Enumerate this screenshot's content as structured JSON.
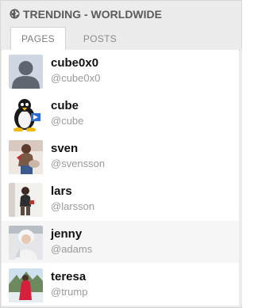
{
  "header": {
    "title": "TRENDING - WORLDWIDE",
    "icon": "globe-icon"
  },
  "tabs": [
    {
      "label": "PAGES",
      "active": true
    },
    {
      "label": "POSTS",
      "active": false
    }
  ],
  "users": [
    {
      "name": "cube0x0",
      "handle": "@cube0x0",
      "avatar": "default-avatar"
    },
    {
      "name": "cube",
      "handle": "@cube",
      "avatar": "penguin-avatar"
    },
    {
      "name": "sven",
      "handle": "@svensson",
      "avatar": "photo-avatar"
    },
    {
      "name": "lars",
      "handle": "@larsson",
      "avatar": "photo-avatar"
    },
    {
      "name": "jenny",
      "handle": "@adams",
      "avatar": "photo-avatar"
    },
    {
      "name": "teresa",
      "handle": "@trump",
      "avatar": "photo-avatar"
    }
  ],
  "colors": {
    "header_text": "#5b5b5b",
    "widget_bg": "#ececec",
    "handle_text": "#9a9a9a"
  }
}
